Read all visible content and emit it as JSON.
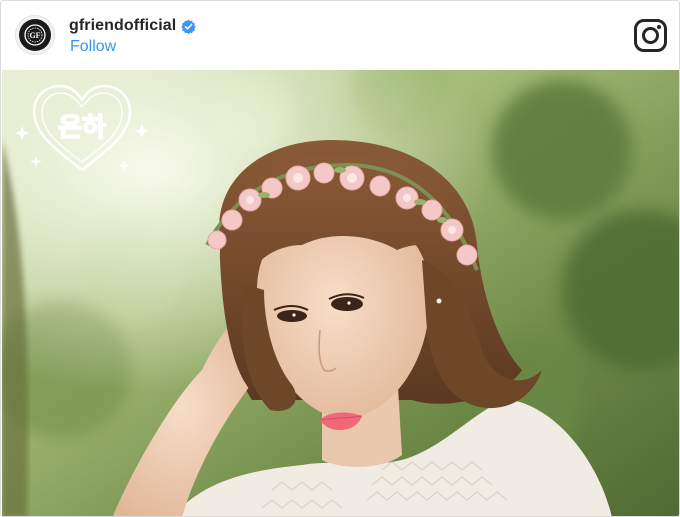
{
  "post": {
    "username": "gfriendofficial",
    "follow_label": "Follow",
    "verified_icon": "verified-badge-icon",
    "profile_icon": "gfriend-emblem-icon",
    "app_icon": "instagram-icon",
    "photo_overlay_logo": "eunha-heart-logo"
  },
  "colors": {
    "username": "#262626",
    "follow": "#3897f0",
    "verified": "#3897f0",
    "border": "#dbdbdb"
  }
}
